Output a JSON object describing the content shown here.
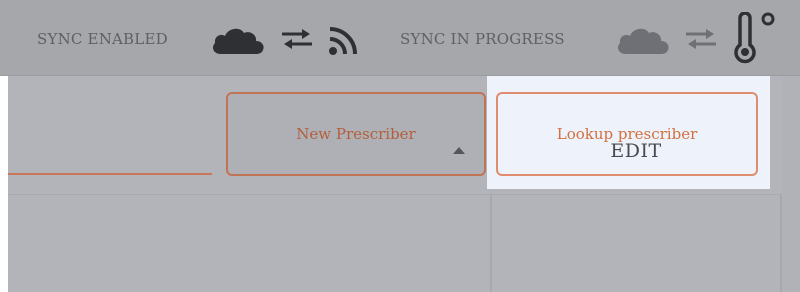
{
  "status_bar": {
    "sync_enabled_label": "SYNC ENABLED",
    "sync_in_progress_label": "SYNC IN PROGRESS",
    "icons": {
      "enabled": [
        "cloud-icon",
        "sync-arrows-icon",
        "rss-feed-icon"
      ],
      "in_progress": [
        "cloud-icon",
        "sync-arrows-icon",
        "thermometer-icon"
      ]
    }
  },
  "actions": {
    "new_prescriber_label": "New Prescriber",
    "lookup_prescriber_label": "Lookup prescriber"
  },
  "table": {
    "edit_header": "EDIT"
  },
  "colors": {
    "accent": "#c17454",
    "accent_highlight": "#df8d6e",
    "dim_overlay": "#a9abb0",
    "highlight_bg": "#eef2fb"
  }
}
